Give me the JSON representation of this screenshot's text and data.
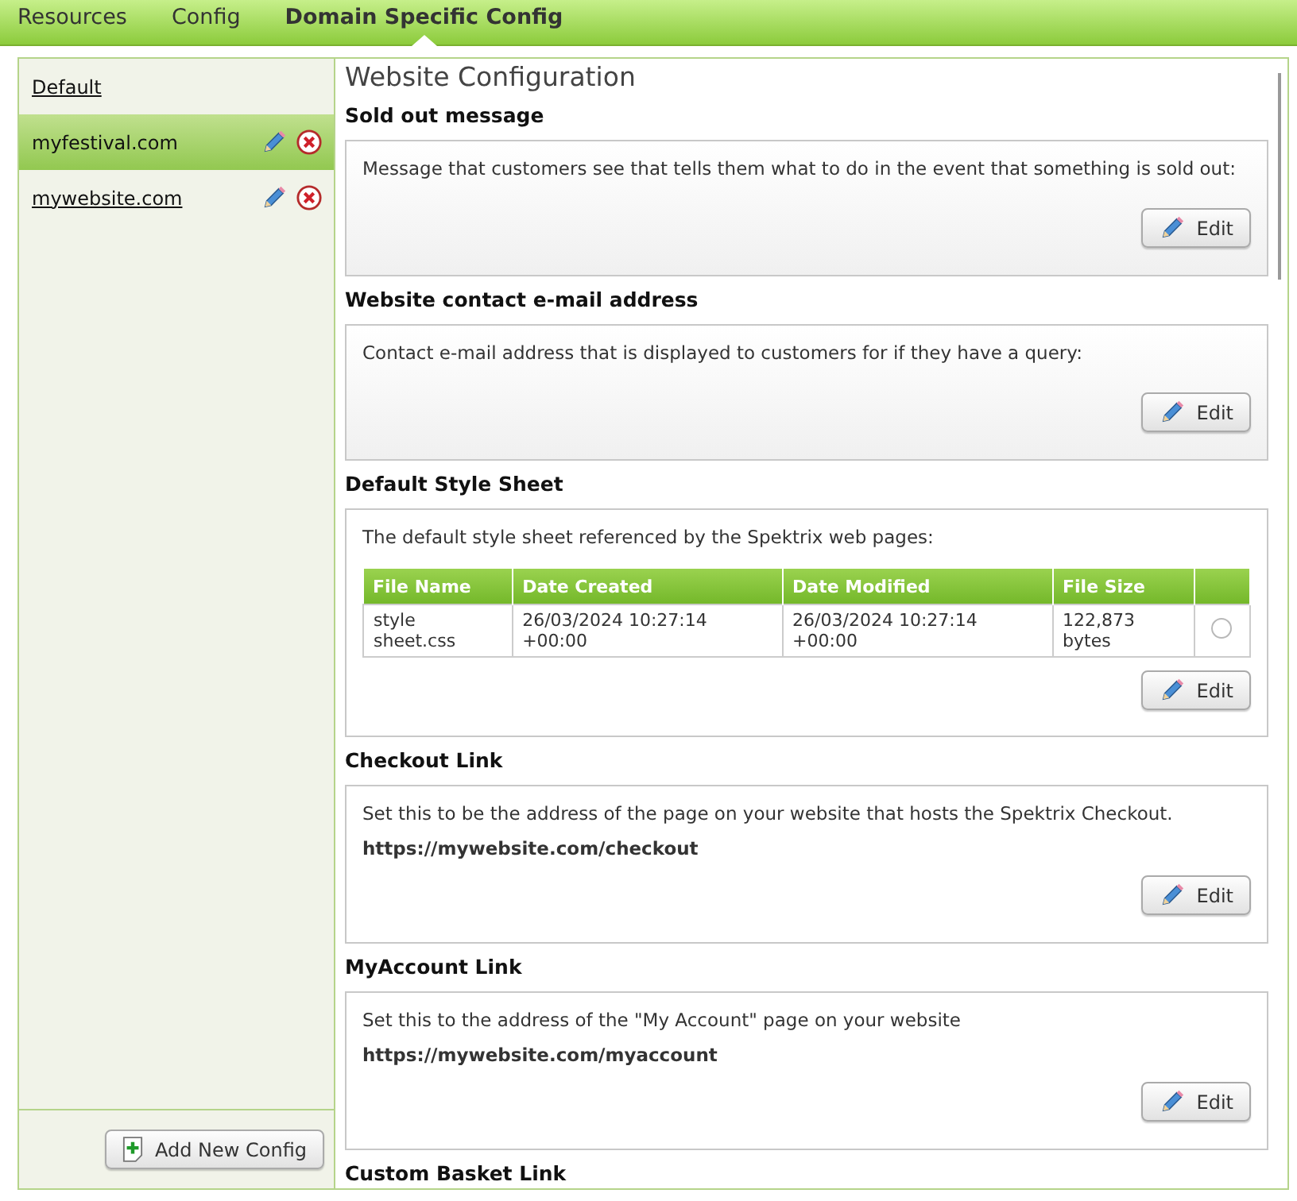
{
  "tabs": [
    {
      "label": "Resources",
      "selected": false
    },
    {
      "label": "Config",
      "selected": false
    },
    {
      "label": "Domain Specific Config",
      "selected": true
    }
  ],
  "sidebar": {
    "items": [
      {
        "label": "Default",
        "selected": false,
        "editable": false
      },
      {
        "label": "myfestival.com",
        "selected": true,
        "editable": true
      },
      {
        "label": "mywebsite.com",
        "selected": false,
        "editable": true
      }
    ],
    "add_button": "Add New Config"
  },
  "content": {
    "title": "Website Configuration",
    "sections": [
      {
        "heading": "Sold out message",
        "description": "Message that customers see that tells them what to do in the event that something is sold out:",
        "shaded": true,
        "edit_button": "Edit"
      },
      {
        "heading": "Website contact e-mail address",
        "description": "Contact e-mail address that is displayed to customers for if they have a query:",
        "shaded": true,
        "edit_button": "Edit"
      },
      {
        "heading": "Default Style Sheet",
        "description": "The default style sheet referenced by the Spektrix web pages:",
        "shaded": false,
        "edit_button": "Edit",
        "table": {
          "columns": [
            "File Name",
            "Date Created",
            "Date Modified",
            "File Size"
          ],
          "rows": [
            {
              "cells": [
                "style sheet.css",
                "26/03/2024 10:27:14 +00:00",
                "26/03/2024 10:27:14 +00:00",
                "122,873 bytes"
              ],
              "selected": false
            }
          ]
        }
      },
      {
        "heading": "Checkout Link",
        "description": "Set this to be the address of the page on your website that hosts the Spektrix Checkout.",
        "value": "https://mywebsite.com/checkout",
        "shaded": false,
        "edit_button": "Edit"
      },
      {
        "heading": "MyAccount Link",
        "description": "Set this to the address of the \"My Account\" page on your website",
        "value": "https://mywebsite.com/myaccount",
        "shaded": false,
        "edit_button": "Edit"
      },
      {
        "heading": "Custom Basket Link"
      }
    ]
  }
}
